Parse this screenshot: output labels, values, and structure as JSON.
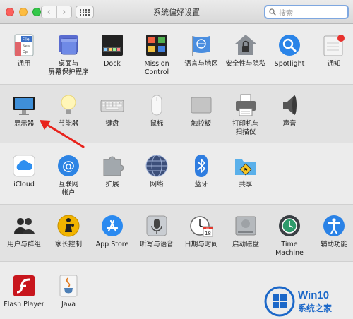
{
  "window": {
    "title": "系统偏好设置"
  },
  "toolbar": {
    "back": "‹",
    "forward": "›"
  },
  "search": {
    "placeholder": "搜索"
  },
  "rows": {
    "r1": [
      "通用",
      "桌面与\n屏幕保护程序",
      "Dock",
      "Mission\nControl",
      "语言与地区",
      "安全性与隐私",
      "Spotlight",
      "通知"
    ],
    "r2": [
      "显示器",
      "节能器",
      "键盘",
      "鼠标",
      "触控板",
      "打印机与\n扫描仪",
      "声音"
    ],
    "r3": [
      "iCloud",
      "互联网\n帐户",
      "扩展",
      "网络",
      "蓝牙",
      "共享"
    ],
    "r4": [
      "用户与群组",
      "家长控制",
      "App Store",
      "听写与语音",
      "日期与时间",
      "启动磁盘",
      "Time Machine",
      "辅助功能"
    ],
    "r5": [
      "Flash Player",
      "Java"
    ]
  },
  "icon_text": {
    "general_file": "File",
    "general_new": "New",
    "general_op": "Op",
    "calendar_month": "JUL",
    "calendar_day": "18"
  },
  "watermark": {
    "brand": "Win10",
    "subtitle": "系统之家"
  }
}
